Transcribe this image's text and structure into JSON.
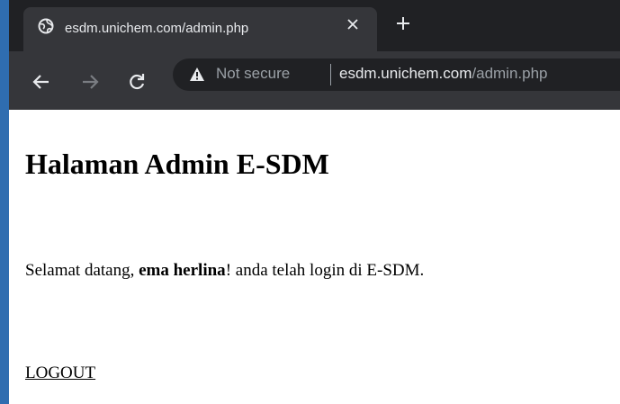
{
  "browser": {
    "tab": {
      "title": "esdm.unichem.com/admin.php",
      "favicon": "globe-icon"
    },
    "toolbar": {
      "security_label": "Not secure",
      "url_host": "esdm.unichem.com",
      "url_path": "/admin.php"
    },
    "colors": {
      "tabstrip_bg": "#202124",
      "toolbar_bg": "#35363a",
      "omnibox_bg": "#202124",
      "text_light": "#e8eaed",
      "text_muted": "#9aa0a6",
      "window_edge": "#2f6db0"
    }
  },
  "page": {
    "title": "Halaman Admin E-SDM",
    "welcome": {
      "prefix": "Selamat datang, ",
      "user": "ema herlina",
      "suffix": "! anda telah login di E-SDM."
    },
    "logout_label": "LOGOUT"
  }
}
